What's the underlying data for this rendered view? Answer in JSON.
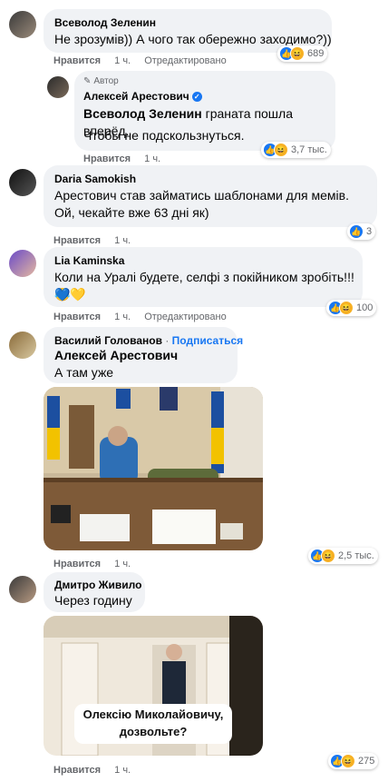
{
  "comments": [
    {
      "author": "Всеволод Зеленин",
      "text": "Не зрозумів)) А чого так обережно заходимо?))",
      "reaction_count": "689",
      "like_label": "Нравится",
      "time": "1 ч.",
      "edited_label": "Отредактировано"
    },
    {
      "author_badge": "Автор",
      "author": "Алексей Арестович",
      "mention": "Всеволод Зеленин",
      "text_after_mention": " граната пошла вперёд.",
      "text2": "Чтобы не подскользнуться.",
      "reaction_count": "3,7 тыс."
    },
    {
      "author": "Daria Samokish",
      "text": "Арестович став займатись шаблонами для мемів. Ой, чекайте вже 63 дні як)",
      "reaction_count": "3",
      "like_label": "Нравится",
      "time": "1 ч."
    },
    {
      "author": "Lia Kaminska",
      "text": "Коли на Уралі будете, селфі з покійником зробіть!!!",
      "emoji_end": "😂",
      "emoji_line": "💙💛",
      "reaction_count": "100",
      "like_label": "Нравится",
      "time": "1 ч.",
      "edited_label": "Отредактировано"
    },
    {
      "author": "Василий Голованов",
      "separator": "·",
      "subscribe_label": "Подписаться",
      "mention": "Алексей Арестович",
      "text": "А там уже",
      "reaction_count": "2,5 тыс.",
      "like_label": "Нравится",
      "time": "1 ч."
    },
    {
      "author": "Дмитро Живило",
      "text": "Через годину",
      "image_caption": "Олексію Миколайовичу, дозвольте?",
      "reaction_count": "275",
      "like_label": "Нравится",
      "time": "1 ч."
    }
  ],
  "colors": {
    "bubble": "#f0f2f5",
    "link": "#1877f2",
    "meta": "#65676b",
    "like_icon": "#1877f2",
    "haha_icon": "#f7b125"
  },
  "icons": [
    "like-icon",
    "haha-icon",
    "verified-icon",
    "avatar"
  ]
}
